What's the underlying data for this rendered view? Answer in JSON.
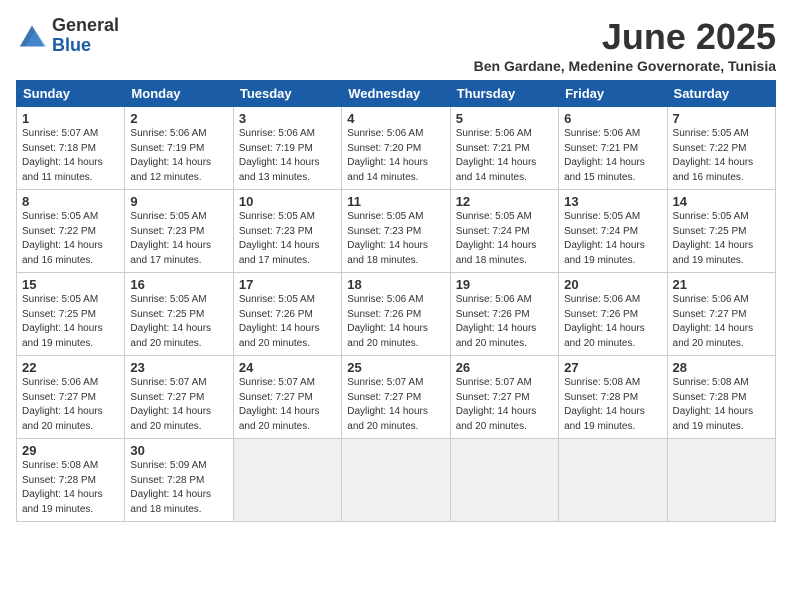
{
  "logo": {
    "general": "General",
    "blue": "Blue"
  },
  "title": "June 2025",
  "subtitle": "Ben Gardane, Medenine Governorate, Tunisia",
  "days_of_week": [
    "Sunday",
    "Monday",
    "Tuesday",
    "Wednesday",
    "Thursday",
    "Friday",
    "Saturday"
  ],
  "weeks": [
    [
      {
        "day": "1",
        "info": "Sunrise: 5:07 AM\nSunset: 7:18 PM\nDaylight: 14 hours\nand 11 minutes."
      },
      {
        "day": "2",
        "info": "Sunrise: 5:06 AM\nSunset: 7:19 PM\nDaylight: 14 hours\nand 12 minutes."
      },
      {
        "day": "3",
        "info": "Sunrise: 5:06 AM\nSunset: 7:19 PM\nDaylight: 14 hours\nand 13 minutes."
      },
      {
        "day": "4",
        "info": "Sunrise: 5:06 AM\nSunset: 7:20 PM\nDaylight: 14 hours\nand 14 minutes."
      },
      {
        "day": "5",
        "info": "Sunrise: 5:06 AM\nSunset: 7:21 PM\nDaylight: 14 hours\nand 14 minutes."
      },
      {
        "day": "6",
        "info": "Sunrise: 5:06 AM\nSunset: 7:21 PM\nDaylight: 14 hours\nand 15 minutes."
      },
      {
        "day": "7",
        "info": "Sunrise: 5:05 AM\nSunset: 7:22 PM\nDaylight: 14 hours\nand 16 minutes."
      }
    ],
    [
      {
        "day": "8",
        "info": "Sunrise: 5:05 AM\nSunset: 7:22 PM\nDaylight: 14 hours\nand 16 minutes."
      },
      {
        "day": "9",
        "info": "Sunrise: 5:05 AM\nSunset: 7:23 PM\nDaylight: 14 hours\nand 17 minutes."
      },
      {
        "day": "10",
        "info": "Sunrise: 5:05 AM\nSunset: 7:23 PM\nDaylight: 14 hours\nand 17 minutes."
      },
      {
        "day": "11",
        "info": "Sunrise: 5:05 AM\nSunset: 7:23 PM\nDaylight: 14 hours\nand 18 minutes."
      },
      {
        "day": "12",
        "info": "Sunrise: 5:05 AM\nSunset: 7:24 PM\nDaylight: 14 hours\nand 18 minutes."
      },
      {
        "day": "13",
        "info": "Sunrise: 5:05 AM\nSunset: 7:24 PM\nDaylight: 14 hours\nand 19 minutes."
      },
      {
        "day": "14",
        "info": "Sunrise: 5:05 AM\nSunset: 7:25 PM\nDaylight: 14 hours\nand 19 minutes."
      }
    ],
    [
      {
        "day": "15",
        "info": "Sunrise: 5:05 AM\nSunset: 7:25 PM\nDaylight: 14 hours\nand 19 minutes."
      },
      {
        "day": "16",
        "info": "Sunrise: 5:05 AM\nSunset: 7:25 PM\nDaylight: 14 hours\nand 20 minutes."
      },
      {
        "day": "17",
        "info": "Sunrise: 5:05 AM\nSunset: 7:26 PM\nDaylight: 14 hours\nand 20 minutes."
      },
      {
        "day": "18",
        "info": "Sunrise: 5:06 AM\nSunset: 7:26 PM\nDaylight: 14 hours\nand 20 minutes."
      },
      {
        "day": "19",
        "info": "Sunrise: 5:06 AM\nSunset: 7:26 PM\nDaylight: 14 hours\nand 20 minutes."
      },
      {
        "day": "20",
        "info": "Sunrise: 5:06 AM\nSunset: 7:26 PM\nDaylight: 14 hours\nand 20 minutes."
      },
      {
        "day": "21",
        "info": "Sunrise: 5:06 AM\nSunset: 7:27 PM\nDaylight: 14 hours\nand 20 minutes."
      }
    ],
    [
      {
        "day": "22",
        "info": "Sunrise: 5:06 AM\nSunset: 7:27 PM\nDaylight: 14 hours\nand 20 minutes."
      },
      {
        "day": "23",
        "info": "Sunrise: 5:07 AM\nSunset: 7:27 PM\nDaylight: 14 hours\nand 20 minutes."
      },
      {
        "day": "24",
        "info": "Sunrise: 5:07 AM\nSunset: 7:27 PM\nDaylight: 14 hours\nand 20 minutes."
      },
      {
        "day": "25",
        "info": "Sunrise: 5:07 AM\nSunset: 7:27 PM\nDaylight: 14 hours\nand 20 minutes."
      },
      {
        "day": "26",
        "info": "Sunrise: 5:07 AM\nSunset: 7:27 PM\nDaylight: 14 hours\nand 20 minutes."
      },
      {
        "day": "27",
        "info": "Sunrise: 5:08 AM\nSunset: 7:28 PM\nDaylight: 14 hours\nand 19 minutes."
      },
      {
        "day": "28",
        "info": "Sunrise: 5:08 AM\nSunset: 7:28 PM\nDaylight: 14 hours\nand 19 minutes."
      }
    ],
    [
      {
        "day": "29",
        "info": "Sunrise: 5:08 AM\nSunset: 7:28 PM\nDaylight: 14 hours\nand 19 minutes."
      },
      {
        "day": "30",
        "info": "Sunrise: 5:09 AM\nSunset: 7:28 PM\nDaylight: 14 hours\nand 18 minutes."
      },
      {
        "day": "",
        "info": ""
      },
      {
        "day": "",
        "info": ""
      },
      {
        "day": "",
        "info": ""
      },
      {
        "day": "",
        "info": ""
      },
      {
        "day": "",
        "info": ""
      }
    ]
  ]
}
